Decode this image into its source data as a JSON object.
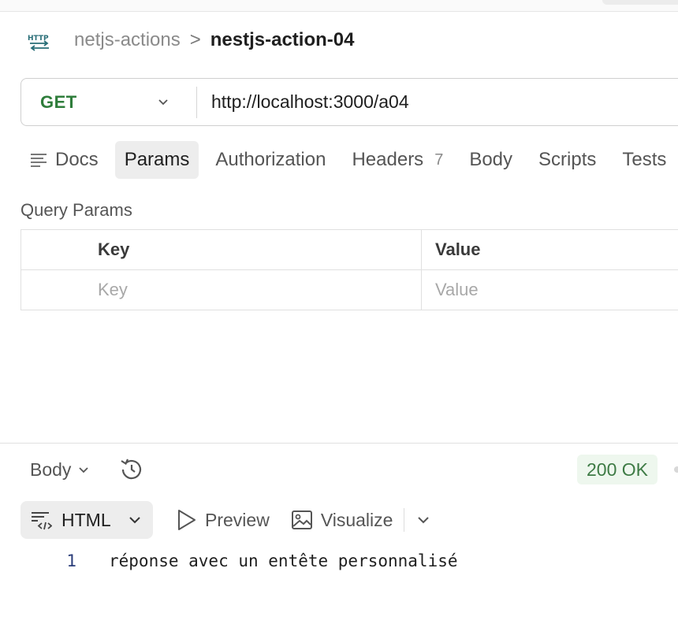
{
  "breadcrumb": {
    "icon": "http-icon",
    "parent": "netjs-actions",
    "separator": ">",
    "current": "nestjs-action-04"
  },
  "request": {
    "method": "GET",
    "method_color": "#2f7d3b",
    "url": "http://localhost:3000/a04"
  },
  "tabs": [
    {
      "label": "Docs",
      "icon": "docs-icon"
    },
    {
      "label": "Params",
      "active": true
    },
    {
      "label": "Authorization"
    },
    {
      "label": "Headers",
      "count": "7"
    },
    {
      "label": "Body"
    },
    {
      "label": "Scripts"
    },
    {
      "label": "Tests"
    }
  ],
  "query_params": {
    "title": "Query Params",
    "columns": [
      "Key",
      "Value"
    ],
    "placeholders": {
      "key": "Key",
      "value": "Value"
    }
  },
  "response": {
    "body_toggle": "Body",
    "status": "200 OK",
    "status_color": "#3e7b45",
    "format": "HTML",
    "preview_label": "Preview",
    "visualize_label": "Visualize",
    "lines": [
      {
        "number": "1",
        "text": "réponse avec un entête personnalisé"
      }
    ]
  }
}
